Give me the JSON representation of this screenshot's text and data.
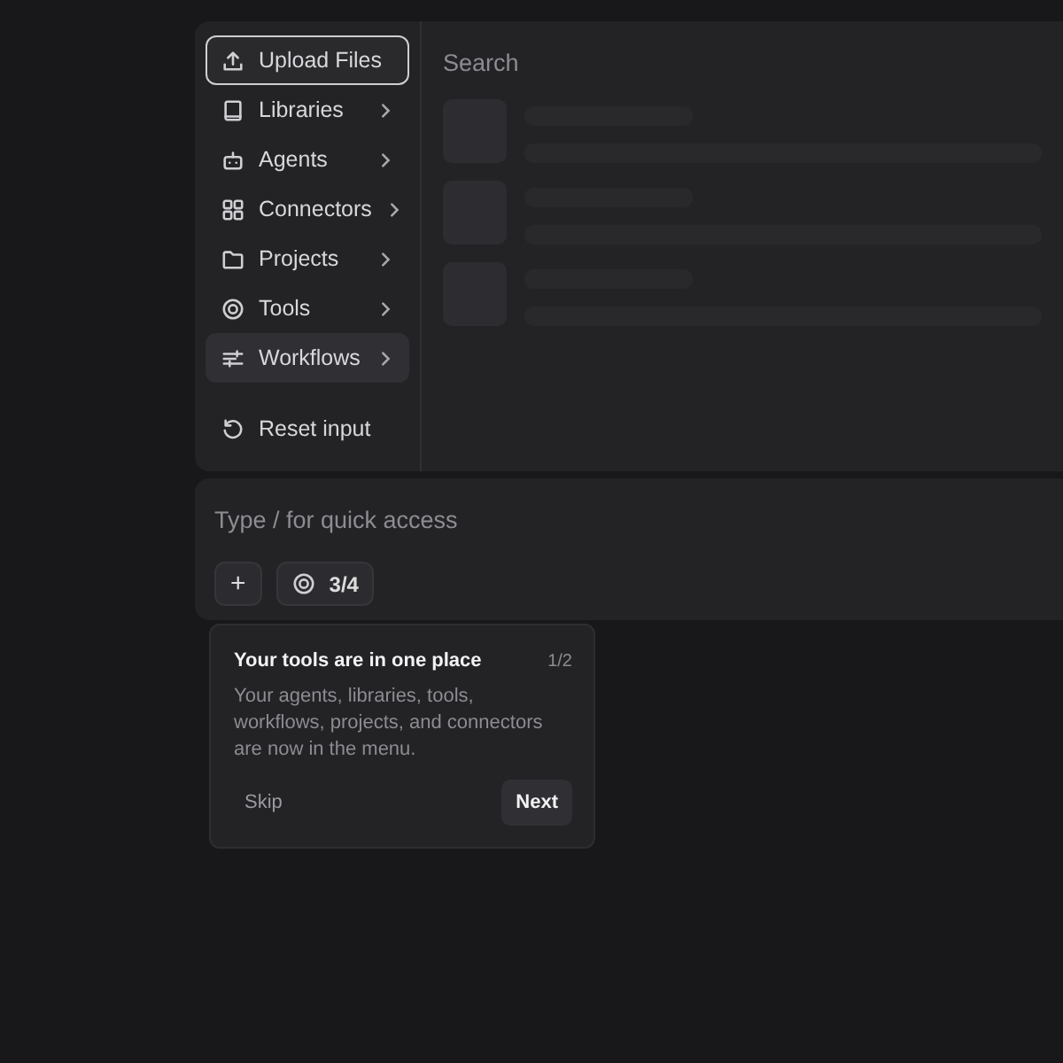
{
  "menu": {
    "items": [
      {
        "kind": "action",
        "label": "Upload Files",
        "focused": true,
        "highlighted": false
      },
      {
        "kind": "submenu",
        "label": "Libraries",
        "focused": false,
        "highlighted": false
      },
      {
        "kind": "submenu",
        "label": "Agents",
        "focused": false,
        "highlighted": false
      },
      {
        "kind": "submenu",
        "label": "Connectors",
        "focused": false,
        "highlighted": false
      },
      {
        "kind": "submenu",
        "label": "Projects",
        "focused": false,
        "highlighted": false
      },
      {
        "kind": "submenu",
        "label": "Tools",
        "focused": false,
        "highlighted": false
      },
      {
        "kind": "submenu",
        "label": "Workflows",
        "focused": false,
        "highlighted": true
      },
      {
        "kind": "reset",
        "label": "Reset input",
        "focused": false,
        "highlighted": false
      }
    ],
    "search": {
      "placeholder": "Search"
    },
    "results": [
      {
        "kind": "skeleton"
      },
      {
        "kind": "skeleton"
      },
      {
        "kind": "skeleton"
      }
    ]
  },
  "composer": {
    "placeholder": "Type / for quick access",
    "add_button": "+",
    "tools_button": "3/4"
  },
  "tour": {
    "title": "Your tools are in one place",
    "step": "1/2",
    "body": "Your agents, libraries, tools, workflows, projects, and connectors are now in the menu.",
    "skip": "Skip",
    "next": "Next"
  }
}
